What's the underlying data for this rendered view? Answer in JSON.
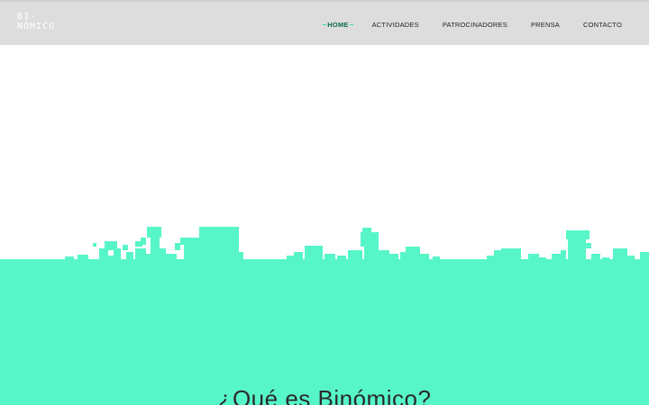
{
  "brand": {
    "logo_line1": "BI-",
    "logo_line2": "NÓMICO"
  },
  "nav": {
    "items": [
      {
        "label": "HOME",
        "active": true
      },
      {
        "label": "ACTIVIDADES",
        "active": false
      },
      {
        "label": "PATROCINADORES",
        "active": false
      },
      {
        "label": "PRENSA",
        "active": false
      },
      {
        "label": "CONTACTO",
        "active": false
      }
    ]
  },
  "hero": {
    "accent_color": "#57f6c8"
  },
  "section": {
    "heading": "¿Qué es Binómico?"
  }
}
